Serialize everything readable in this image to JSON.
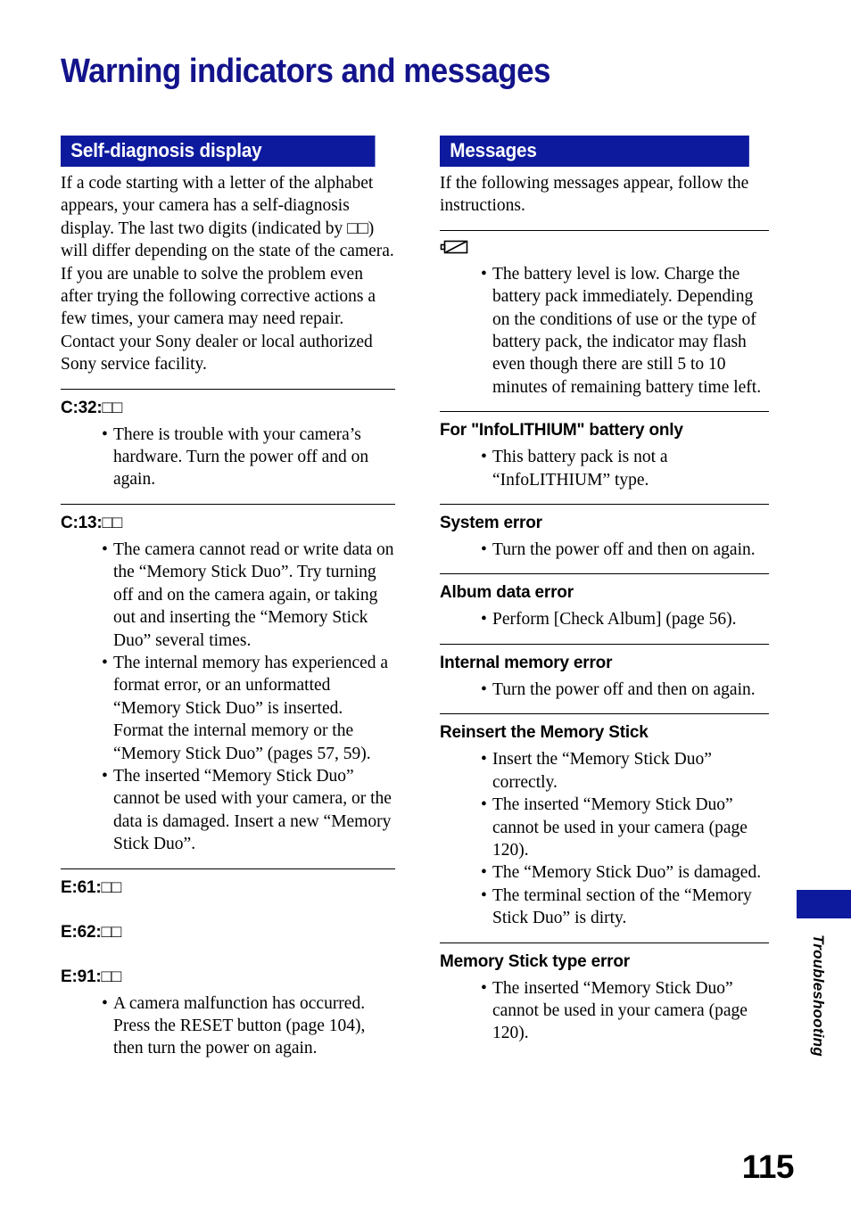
{
  "page": {
    "title": "Warning indicators and messages",
    "number": "115",
    "side_tab_label": "Troubleshooting",
    "accent_color": "#0d1a9e",
    "title_color": "#13138c"
  },
  "left_column": {
    "banner": "Self-diagnosis display",
    "intro_paragraphs": [
      "If a code starting with a letter of the alphabet appears, your camera has a self-diagnosis display. The last two digits (indicated by □□) will differ depending on the state of the camera.",
      "If you are unable to solve the problem even after trying the following corrective actions a few times, your camera may need repair. Contact your Sony dealer or local authorized Sony service facility."
    ],
    "sections": [
      {
        "heading": "C:32:□□",
        "bullets": [
          "There is trouble with your camera’s hardware. Turn the power off and on again."
        ]
      },
      {
        "heading": "C:13:□□",
        "bullets": [
          "The camera cannot read or write data on the “Memory Stick Duo”. Try turning off and on the camera again, or taking out and inserting the “Memory Stick Duo” several times.",
          "The internal memory has experienced a format error, or an unformatted “Memory Stick Duo” is inserted. Format the internal memory or the “Memory Stick Duo” (pages 57, 59).",
          "The inserted “Memory Stick Duo” cannot be used with your camera, or the data is damaged. Insert a new “Memory Stick Duo”."
        ]
      },
      {
        "heading": "E:61:□□",
        "bullets": []
      },
      {
        "heading": "E:62:□□",
        "bullets": []
      },
      {
        "heading": "E:91:□□",
        "bullets": [
          "A camera malfunction has occurred. Press the RESET button (page 104), then turn the power on again."
        ]
      }
    ]
  },
  "right_column": {
    "banner": "Messages",
    "intro_paragraphs": [
      "If the following messages appear, follow the instructions."
    ],
    "battery_section": {
      "icon_name": "low-battery-icon",
      "bullets": [
        "The battery level is low. Charge the battery pack immediately. Depending on the conditions of use or the type of battery pack, the indicator may flash even though there are still 5 to 10 minutes of remaining battery time left."
      ]
    },
    "sections": [
      {
        "heading": "For \"InfoLITHIUM\" battery only",
        "bullets": [
          "This battery pack is not a “InfoLITHIUM” type."
        ]
      },
      {
        "heading": "System error",
        "bullets": [
          "Turn the power off and then on again."
        ]
      },
      {
        "heading": "Album data error",
        "bullets": [
          "Perform [Check Album] (page 56)."
        ]
      },
      {
        "heading": "Internal memory error",
        "bullets": [
          "Turn the power off and then on again."
        ]
      },
      {
        "heading": "Reinsert the Memory Stick",
        "bullets": [
          "Insert the “Memory Stick Duo” correctly.",
          "The inserted “Memory Stick Duo” cannot be used in your camera (page 120).",
          "The “Memory Stick Duo” is damaged.",
          "The terminal section of the “Memory Stick Duo” is dirty."
        ]
      },
      {
        "heading": "Memory Stick type error",
        "bullets": [
          "The inserted “Memory Stick Duo” cannot be used in your camera (page 120)."
        ]
      }
    ]
  }
}
